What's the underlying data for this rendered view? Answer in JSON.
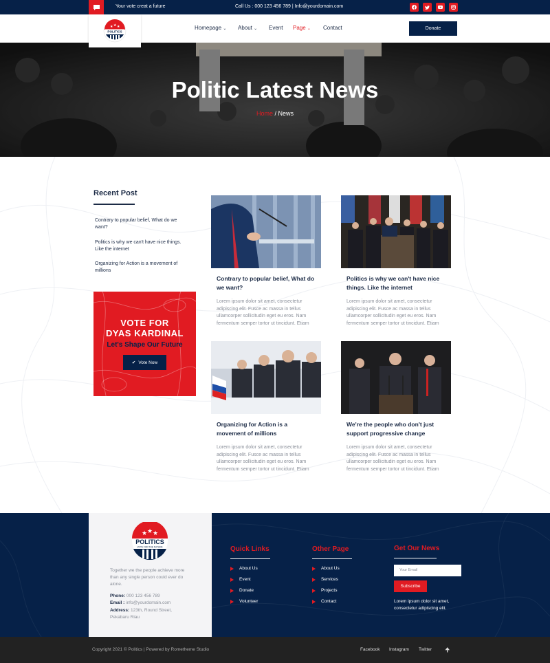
{
  "topbar": {
    "tagline": "Your vote creat a future",
    "contact": "Call Us : 000 123 456 789 | Info@yourdomain.com",
    "social_icons": [
      "facebook-icon",
      "twitter-icon",
      "youtube-icon",
      "instagram-icon"
    ]
  },
  "nav": {
    "logo_text": "POLITICS",
    "items": [
      {
        "label": "Homepage"
      },
      {
        "label": "About"
      },
      {
        "label": "Event"
      },
      {
        "label": "Page"
      },
      {
        "label": "Contact"
      }
    ],
    "active": "Page",
    "donate_label": "Donate"
  },
  "hero": {
    "title": "Politic Latest News",
    "crumb_home": "Home",
    "crumb_sep": "/",
    "crumb_current": "News"
  },
  "sidebar": {
    "recent_title": "Recent Post",
    "recent": [
      "Contrary to popular belief, What do we want?",
      "Politics is why we can't have nice things. Like the internet",
      "Organizing for Action is a movement of millions"
    ],
    "vote": {
      "line1": "VOTE FOR",
      "line2": "DYAS KARDINAL",
      "line3": "Let's Shape Our Future",
      "button": "Vote Now"
    }
  },
  "posts": [
    {
      "title": "Contrary to popular belief, What do we want?",
      "excerpt": "Lorem ipsum dolor sit amet, consectetur adipiscing elit. Fusce ac massa in tellus ullamcorper sollicitudin eget eu eros. Nam fermentum semper tortor ut tincidunt. Etiam"
    },
    {
      "title": "Politics is why we can't have nice things. Like the internet",
      "excerpt": "Lorem ipsum dolor sit amet, consectetur adipiscing elit. Fusce ac massa in tellus ullamcorper sollicitudin eget eu eros. Nam fermentum semper tortor ut tincidunt. Etiam"
    },
    {
      "title": "Organizing for Action is a movement of millions",
      "excerpt": "Lorem ipsum dolor sit amet, consectetur adipiscing elit. Fusce ac massa in tellus ullamcorper sollicitudin eget eu eros. Nam fermentum semper tortor ut tincidunt. Etiam"
    },
    {
      "title": "We're the people who don't just support progressive change",
      "excerpt": "Lorem ipsum dolor sit amet, consectetur adipiscing elit. Fusce ac massa in tellus ullamcorper sollicitudin eget eu eros. Nam fermentum semper tortor ut tincidunt. Etiam"
    }
  ],
  "footer": {
    "logo_text": "POLITICS",
    "logo_sub": "VOTE FOR THE FUTURE",
    "desc": "Together we the people achieve more than any single person could ever do alone.",
    "phone_label": "Phone:",
    "phone": "000 123 456 789",
    "email_label": "Email :",
    "email": "info@yourdomain.com",
    "address_label": "Address:",
    "address": "123th, Round Street, Pekabaru Riau",
    "quick_title": "Quick Links",
    "quick": [
      "About Us",
      "Event",
      "Donate",
      "Volunteer"
    ],
    "other_title": "Other Page",
    "other": [
      "About Us",
      "Services",
      "Projects",
      "Contact"
    ],
    "news_title": "Get Our News",
    "email_placeholder": "Your Email",
    "subscribe": "Subscribe",
    "news_text": "Lorem ipsum dolor sit amet, consectetur adipiscing elit."
  },
  "bottom": {
    "copyright": "Copyright 2021 © Politics | Powered by Rometheme Studio",
    "links": [
      "Facebook",
      "Instagram",
      "Twitter"
    ],
    "up_icon": "arrow-up-icon"
  },
  "colors": {
    "navy": "#062148",
    "red": "#e11b22"
  }
}
